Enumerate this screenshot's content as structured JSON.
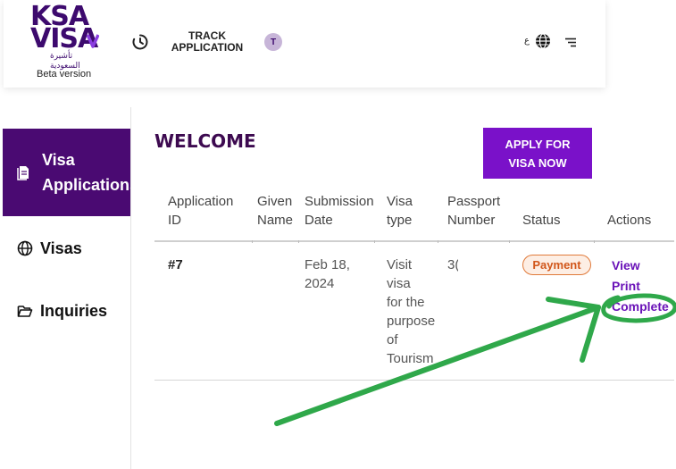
{
  "header": {
    "logo": {
      "line1": "KSA",
      "line2": "VISA",
      "arabic": "تأشيرة السعودية",
      "beta": "Beta version"
    },
    "track_application": "TRACK\nAPPLICATION",
    "avatar_initial": "T",
    "lang_label": "ع",
    "icons": {
      "track": "clock-icon",
      "language": "globe-icon",
      "menu": "menu-icon"
    }
  },
  "sidebar": {
    "items": [
      {
        "label": "Visa Applications",
        "icon": "document-icon",
        "active": true
      },
      {
        "label": "Visas",
        "icon": "globe-icon",
        "active": false
      },
      {
        "label": "Inquiries",
        "icon": "folder-icon",
        "active": false
      }
    ]
  },
  "main": {
    "welcome": "WELCOME",
    "apply_button": "APPLY FOR\nVISA NOW",
    "table": {
      "headers": [
        "Application\nID",
        "Given\nName",
        "Submission\nDate",
        "Visa\ntype",
        "Passport\nNumber",
        "Status",
        "Actions"
      ],
      "rows": [
        {
          "id": "#7",
          "given_name": "",
          "submission_date": "Feb 18,\n2024",
          "visa_type": "Visit\nvisa\nfor the\npurpose\nof\nTourism",
          "passport_number": "3(",
          "status": "Payment",
          "actions": [
            "View",
            "Print",
            "Complete"
          ]
        }
      ]
    }
  },
  "colors": {
    "brand_purple": "#4a0a72",
    "button_purple": "#7a11c9",
    "link_purple": "#6a12b8",
    "status_orange": "#d1561a",
    "annotation_green": "#2fa84a"
  }
}
